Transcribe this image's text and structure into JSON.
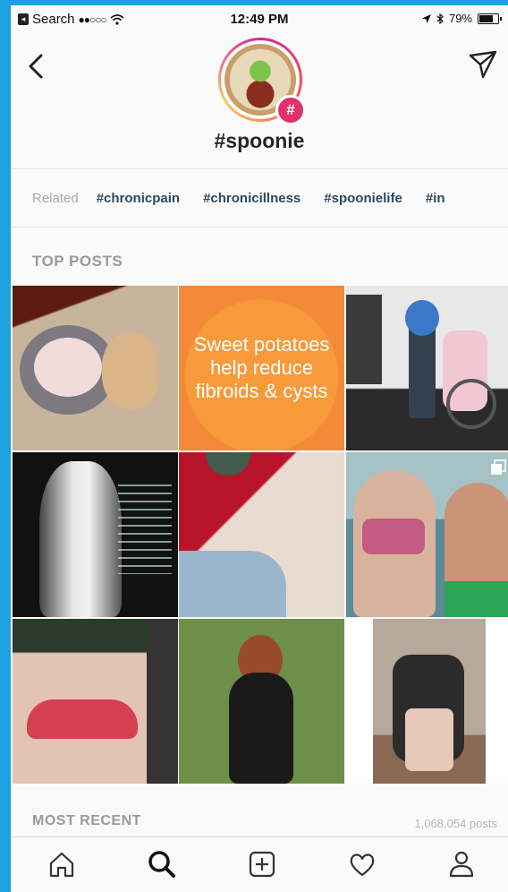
{
  "status_bar": {
    "carrier": "Search",
    "signal": "●●○○○",
    "time": "12:49 PM",
    "battery": "79%"
  },
  "header": {
    "hashtag": "#spoonie",
    "badge_symbol": "#"
  },
  "related": {
    "label": "Related",
    "tags": [
      "#chronicpain",
      "#chronicillness",
      "#spoonielife",
      "#in"
    ]
  },
  "top_posts": {
    "label": "TOP POSTS",
    "quote_text": "Sweet potatoes help reduce fibroids & cysts"
  },
  "most_recent": {
    "label": "MOST RECENT",
    "post_count": "1,068,054 posts"
  },
  "tab_bar": {
    "items": [
      "home-icon",
      "search-icon",
      "add-icon",
      "heart-icon",
      "profile-icon"
    ]
  },
  "colors": {
    "background": "#1ea1e0",
    "tag_link": "#2c4963",
    "badge": "#e1306c"
  }
}
